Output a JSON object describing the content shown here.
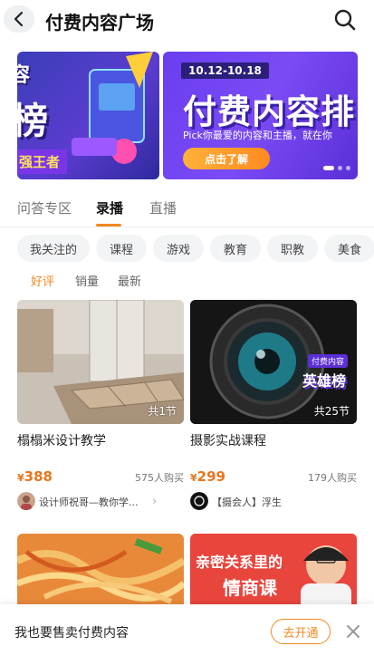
{
  "header": {
    "title": "付费内容广场"
  },
  "banner": {
    "left": {
      "line1": "容",
      "line2": "榜",
      "tag": "强王者"
    },
    "right": {
      "date": "10.12-10.18",
      "headline": "付费内容排",
      "sub": "Pick你最爱的内容和主播，就在你",
      "cta": "点击了解"
    }
  },
  "tabs": [
    "问答专区",
    "录播",
    "直播"
  ],
  "categories": [
    "我关注的",
    "课程",
    "游戏",
    "教育",
    "职教",
    "美食"
  ],
  "sort": [
    "好评",
    "销量",
    "最新"
  ],
  "cards": [
    {
      "badge": "共1节",
      "title": "榻榻米设计教学",
      "price_symbol": "¥",
      "price": "388",
      "buyers": "575人购买",
      "author": "设计师祝哥—教你学..."
    },
    {
      "badge": "共25节",
      "title": "摄影实战课程",
      "price_symbol": "¥",
      "price": "299",
      "buyers": "179人购买",
      "author": "【摄会人】浮生",
      "overlay_small": "付费内容",
      "overlay_big": "英雄榜"
    },
    {
      "overlay": ""
    },
    {
      "overlay": "亲密关系里的",
      "overlay2": "情商课"
    }
  ],
  "bottom": {
    "text": "我也要售卖付费内容",
    "button": "去开通"
  },
  "colors": {
    "accent": "#f08a24",
    "price": "#e8761c"
  }
}
